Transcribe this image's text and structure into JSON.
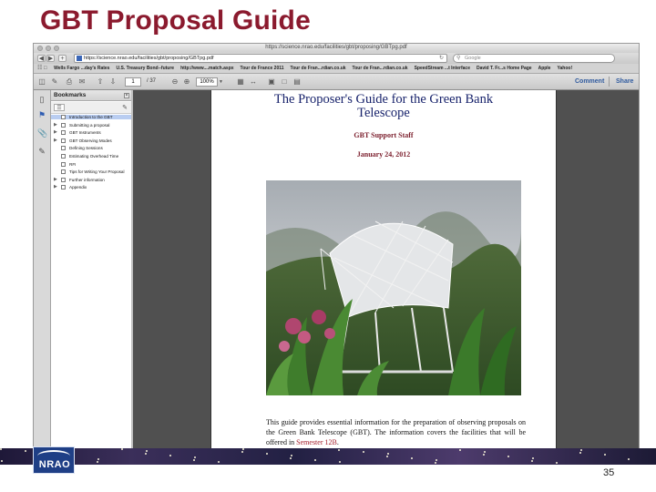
{
  "slide": {
    "title": "GBT Proposal Guide",
    "page_number": "35",
    "logo_text": "NRAO"
  },
  "browser": {
    "window_title": "https://science.nrao.edu/facilities/gbt/proposing/GBTpg.pdf",
    "url": "https://science.nrao.edu/facilities/gbt/proposing/GBTpg.pdf",
    "search_placeholder": "Google",
    "bookmarks": [
      "Wells Fargo ...day's Rates",
      "U.S. Treasury Bond--future",
      "http://www....match.aspx",
      "Tour de France 2011",
      "Tour de Fran...rdian.co.uk",
      "Tour de Fran...rdian.co.uk",
      "SpeedStream ...t Interface",
      "David T. Fr...s Home Page",
      "Apple",
      "Yahoo!"
    ]
  },
  "pdf_toolbar": {
    "page_current": "1",
    "page_total": "/ 37",
    "zoom": "100%",
    "comment_label": "Comment",
    "share_label": "Share"
  },
  "bookmarks_panel": {
    "header": "Bookmarks",
    "items": [
      {
        "label": "Introduction to the GBT",
        "expandable": false,
        "selected": true
      },
      {
        "label": "Submitting a proposal",
        "expandable": true,
        "selected": false
      },
      {
        "label": "GBT Instruments",
        "expandable": true,
        "selected": false
      },
      {
        "label": "GBT Observing Modes",
        "expandable": true,
        "selected": false
      },
      {
        "label": "Defining Sessions",
        "expandable": false,
        "selected": false
      },
      {
        "label": "Estimating Overhead Time",
        "expandable": false,
        "selected": false
      },
      {
        "label": "RFI",
        "expandable": false,
        "selected": false
      },
      {
        "label": "Tips for Writing Your Proposal",
        "expandable": false,
        "selected": false
      },
      {
        "label": "Further information",
        "expandable": true,
        "selected": false
      },
      {
        "label": "Appendix",
        "expandable": true,
        "selected": false
      }
    ]
  },
  "document": {
    "title_line1": "The Proposer's Guide for the Green Bank",
    "title_line2": "Telescope",
    "author": "GBT Support Staff",
    "date": "January 24, 2012",
    "abstract_text": "This guide provides essential information for the preparation of observing proposals on the Green Bank Telescope (GBT). The information covers the facilities that will be offered in",
    "abstract_highlight": "Semester 12B",
    "abstract_end": "."
  },
  "colors": {
    "title": "#8b1a2e",
    "doc_title": "#17226b",
    "doc_author": "#7b1e2c",
    "toolbar_accent": "#2f5a9e",
    "selected_bookmark": "#b9cdf1"
  },
  "icons": {
    "back": "chevron-left-icon",
    "forward": "chevron-right-icon",
    "reload": "reload-icon",
    "search": "search-icon",
    "bookmark_panel": "bookmark-icon",
    "attachments": "paperclip-icon",
    "signatures": "signature-icon"
  }
}
